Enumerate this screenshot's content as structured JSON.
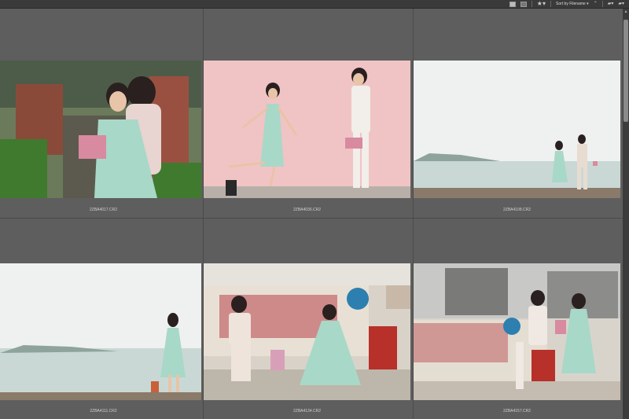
{
  "toolbar": {
    "sort_label": "Sort by Filename",
    "view_icons": [
      "grid-view-icon",
      "list-view-icon"
    ],
    "icons": [
      "star-icon",
      "ascending-icon",
      "new-folder-icon",
      "open-recent-icon"
    ]
  },
  "thumbnails": [
    {
      "filename": "2ZBA4017.CR2"
    },
    {
      "filename": "2ZBA4036.CR2"
    },
    {
      "filename": "2ZBA4108.CR2"
    },
    {
      "filename": "2ZBA4111.CR2"
    },
    {
      "filename": "2ZBA4134.CR2"
    },
    {
      "filename": "2ZBA4157.CR2"
    }
  ]
}
